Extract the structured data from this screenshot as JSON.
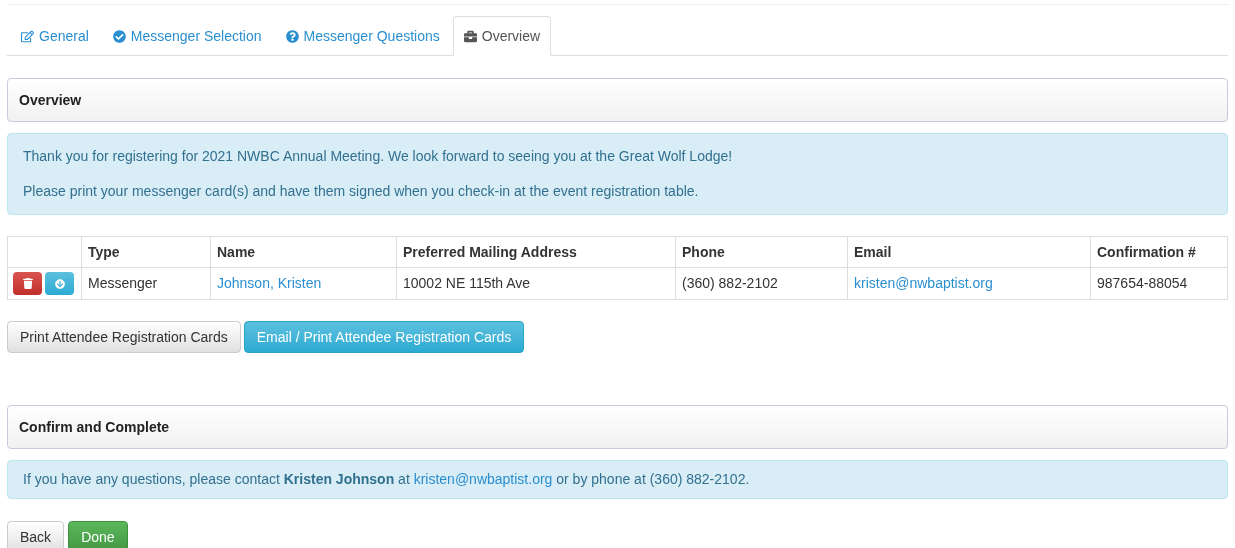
{
  "tabs": [
    {
      "label": "General",
      "kind": "edit",
      "selected": false
    },
    {
      "label": "Messenger Selection",
      "kind": "check",
      "selected": false
    },
    {
      "label": "Messenger Questions",
      "kind": "question",
      "selected": false
    },
    {
      "label": "Overview",
      "kind": "briefcase",
      "selected": true
    }
  ],
  "overview": {
    "title": "Overview",
    "messages": [
      "Thank you for registering for 2021 NWBC Annual Meeting. We look forward to seeing you at the Great Wolf Lodge!",
      "Please print your messenger card(s) and have them signed when you check-in at the event registration table."
    ]
  },
  "table": {
    "columns": [
      "Type",
      "Name",
      "Preferred Mailing Address",
      "Phone",
      "Email",
      "Confirmation #"
    ],
    "rows": [
      {
        "type": "Messenger",
        "name": "Johnson, Kristen",
        "address": "10002 NE 115th Ave",
        "phone": "(360) 882-2102",
        "email": "kristen@nwbaptist.org",
        "confirmation": "987654-88054"
      }
    ]
  },
  "print_buttons": [
    {
      "label": "Print Attendee Registration Cards",
      "kind": "default"
    },
    {
      "label": "Email / Print Attendee Registration Cards",
      "kind": "info"
    }
  ],
  "confirm": {
    "title": "Confirm and Complete",
    "contact_before": "If you have any questions, please contact **Kristen Johnson** at ",
    "contact_link": "kristen@nwbaptist.org",
    "contact_after": " or by phone at (360) 882-2102."
  },
  "nav_buttons": [
    {
      "label": "Back",
      "kind": "default"
    },
    {
      "label": "Done",
      "kind": "success"
    }
  ]
}
